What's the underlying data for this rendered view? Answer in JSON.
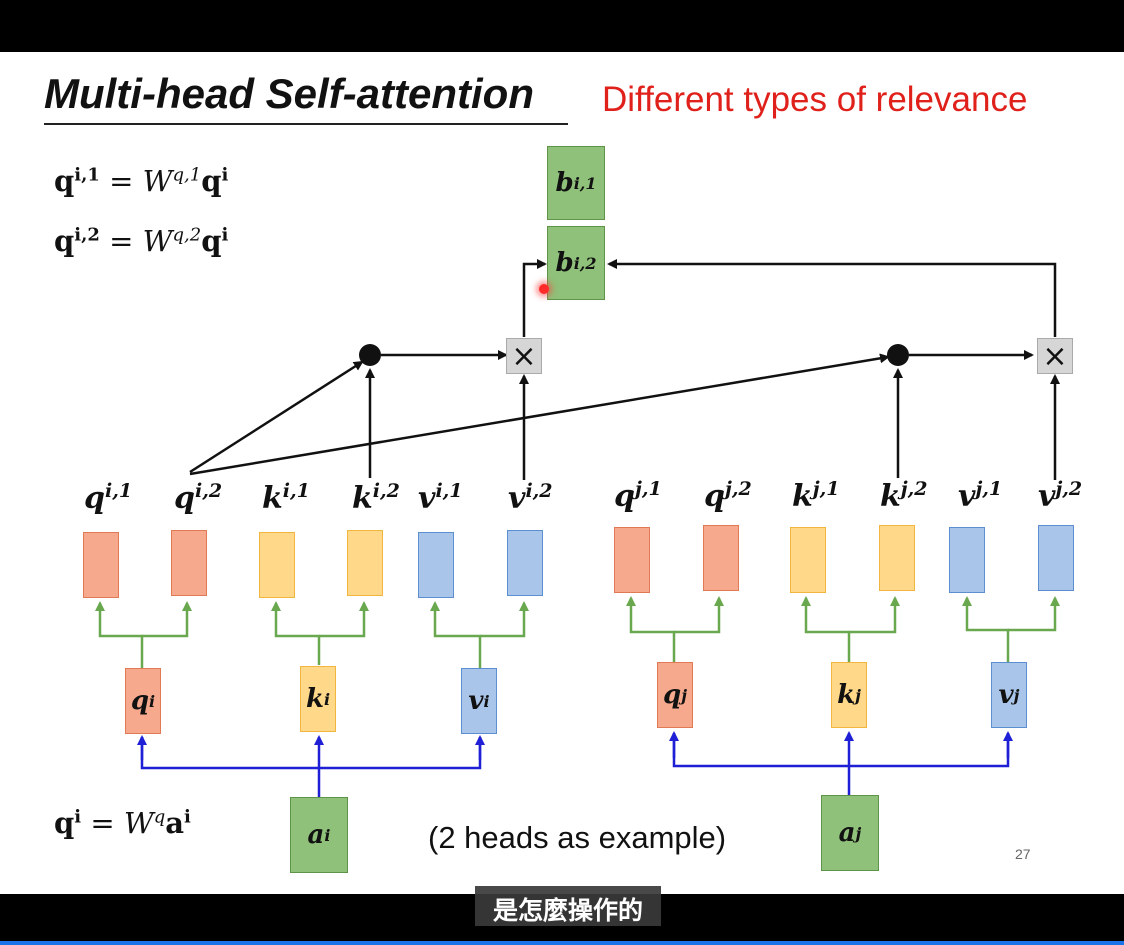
{
  "slide": {
    "title": "Multi-head Self-attention",
    "subtitle": "Different types of relevance",
    "note": "(2 heads as example)",
    "page_number": "27"
  },
  "subtitle_caption": "是怎麼操作的",
  "equations": {
    "eq1": {
      "lhs": "q",
      "lhs_sup": "i,1",
      "eq": " = ",
      "w": "W",
      "w_sup": "q,1",
      "rhs": "q",
      "rhs_sup": "i"
    },
    "eq2": {
      "lhs": "q",
      "lhs_sup": "i,2",
      "eq": " = ",
      "w": "W",
      "w_sup": "q,2",
      "rhs": "q",
      "rhs_sup": "i"
    },
    "eq3": {
      "lhs": "q",
      "lhs_sup": "i",
      "eq": " = ",
      "w": "W",
      "w_sup": "q",
      "rhs": "a",
      "rhs_sup": "i"
    }
  },
  "outputs": [
    {
      "base": "b",
      "sup": "i,1"
    },
    {
      "base": "b",
      "sup": "i,2"
    }
  ],
  "head_labels": [
    {
      "base": "q",
      "sup": "i,1"
    },
    {
      "base": "q",
      "sup": "i,2"
    },
    {
      "base": "k",
      "sup": "i,1"
    },
    {
      "base": "k",
      "sup": "i,2"
    },
    {
      "base": "v",
      "sup": "i,1"
    },
    {
      "base": "v",
      "sup": "i,2"
    },
    {
      "base": "q",
      "sup": "j,1"
    },
    {
      "base": "q",
      "sup": "j,2"
    },
    {
      "base": "k",
      "sup": "j,1"
    },
    {
      "base": "k",
      "sup": "j,2"
    },
    {
      "base": "v",
      "sup": "j,1"
    },
    {
      "base": "v",
      "sup": "j,2"
    }
  ],
  "mid_boxes": [
    {
      "base": "q",
      "sup": "i"
    },
    {
      "base": "k",
      "sup": "i"
    },
    {
      "base": "v",
      "sup": "i"
    },
    {
      "base": "q",
      "sup": "j"
    },
    {
      "base": "k",
      "sup": "j"
    },
    {
      "base": "v",
      "sup": "j"
    }
  ],
  "inputs": [
    {
      "base": "a",
      "sup": "i"
    },
    {
      "base": "a",
      "sup": "j"
    }
  ],
  "multiply_symbol": "×",
  "colors": {
    "title_accent": "#e0201a",
    "query": "#f6a98c",
    "key": "#ffd88a",
    "value": "#a9c6ea",
    "input_output": "#8fc17a",
    "split_wire": "#6aa84f",
    "input_wire": "#1f1fd6"
  }
}
